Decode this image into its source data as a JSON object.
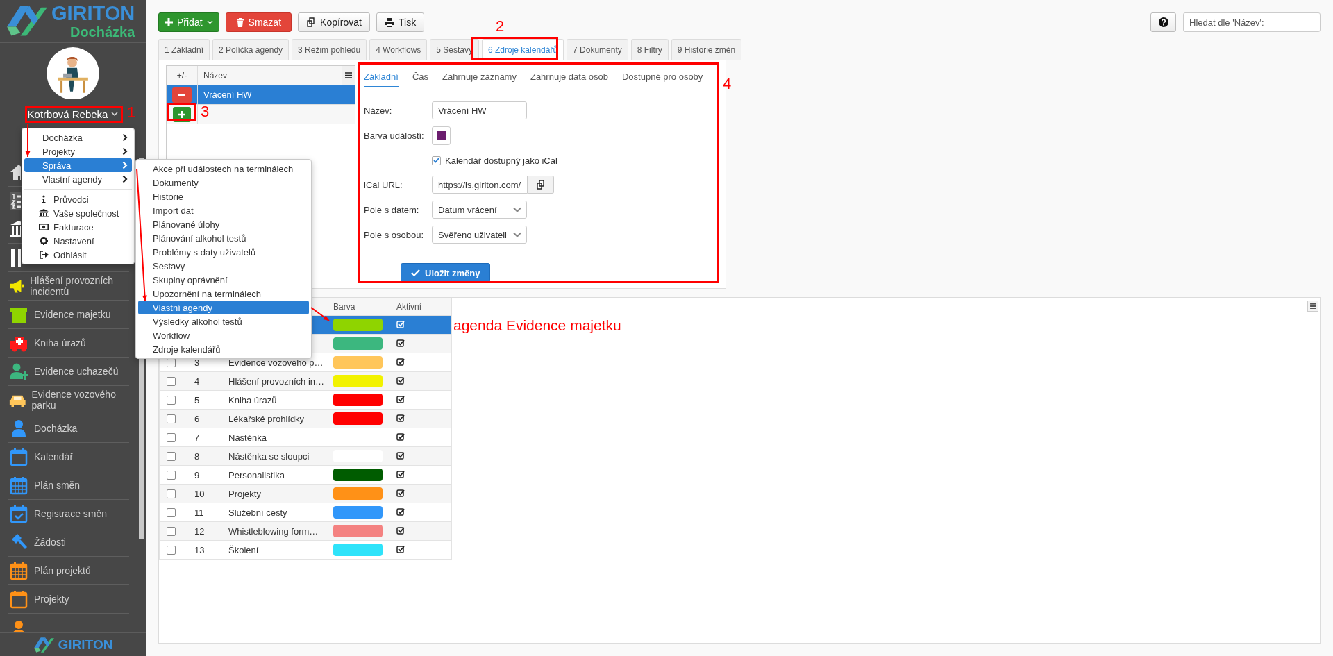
{
  "sidebar": {
    "brand": "GIRITON",
    "product": "Docházka",
    "user": "Kotrbová Rebeka",
    "items": [
      {
        "label": "Hlášení provozních incidentů"
      },
      {
        "label": "Evidence majetku"
      },
      {
        "label": "Kniha úrazů"
      },
      {
        "label": "Evidence uchazečů"
      },
      {
        "label": "Evidence vozového parku"
      },
      {
        "label": "Docházka"
      },
      {
        "label": "Kalendář"
      },
      {
        "label": "Plán směn"
      },
      {
        "label": "Registrace směn"
      },
      {
        "label": "Žádosti"
      },
      {
        "label": "Plán projektů"
      },
      {
        "label": "Projekty"
      }
    ],
    "footer_brand": "GIRITON"
  },
  "toolbar": {
    "buttons": [
      {
        "label": "Přidat",
        "kind": "add"
      },
      {
        "label": "Smazat",
        "kind": "delete"
      },
      {
        "label": "Kopírovat",
        "kind": "copy"
      },
      {
        "label": "Tisk",
        "kind": "print"
      }
    ],
    "search": {
      "placeholder": "Hledat dle 'Název':"
    }
  },
  "tabs": [
    {
      "label": "1 Základní",
      "selected": false
    },
    {
      "label": "2 Políčka agendy",
      "selected": false
    },
    {
      "label": "3 Režim pohledu",
      "selected": false
    },
    {
      "label": "4 Workflows",
      "selected": false
    },
    {
      "label": "5 Sestavy",
      "selected": false
    },
    {
      "label": "6 Zdroje kalendářů",
      "selected": true
    },
    {
      "label": "7 Dokumenty",
      "selected": false
    },
    {
      "label": "8 Filtry",
      "selected": false
    },
    {
      "label": "9 Historie změn",
      "selected": false
    }
  ],
  "sources": {
    "columns": [
      "+/-",
      "Název"
    ],
    "rows": [
      {
        "name": "Vrácení HW",
        "selected": true
      }
    ]
  },
  "editor": {
    "tabs": [
      {
        "label": "Základní",
        "selected": true
      },
      {
        "label": "Čas",
        "selected": false
      },
      {
        "label": "Zahrnuje záznamy",
        "selected": false
      },
      {
        "label": "Zahrnuje data osob",
        "selected": false
      },
      {
        "label": "Dostupné pro osoby",
        "selected": false
      }
    ],
    "fields": [
      {
        "kind": "text",
        "label": "Název:",
        "value": "Vrácení HW"
      },
      {
        "kind": "color",
        "label": "Barva událostí:",
        "color": "#6b1d6e"
      },
      {
        "kind": "checkbox",
        "label": "Kalendář dostupný jako iCal",
        "checked": true
      },
      {
        "kind": "copy",
        "label": "iCal URL:",
        "value": "https://is.giriton.com/"
      },
      {
        "kind": "select",
        "label": "Pole s datem:",
        "value": "Datum vrácení"
      },
      {
        "kind": "select",
        "label": "Pole s osobou:",
        "value": "Svěřeno uživateli"
      }
    ],
    "save": "Uložit změny"
  },
  "agendas": {
    "columns": [
      "Barva",
      "Aktivní"
    ],
    "rows": [
      {
        "color": "#8fd400",
        "active": true,
        "selected": true
      },
      {
        "color": "#3cb77f",
        "active": true,
        "selected": false
      },
      {
        "number": "3",
        "name": "Evidence vozového p…",
        "checked": false,
        "color": "#ffc65a",
        "active": true,
        "selected": false
      },
      {
        "number": "4",
        "name": "Hlášení provozních in…",
        "checked": false,
        "color": "#f2f200",
        "active": true,
        "selected": false
      },
      {
        "number": "5",
        "name": "Kniha úrazů",
        "checked": false,
        "color": "#ff0000",
        "active": true,
        "selected": false
      },
      {
        "number": "6",
        "name": "Lékařské prohlídky",
        "checked": false,
        "color": "#ff0000",
        "active": true,
        "selected": false
      },
      {
        "number": "7",
        "name": "Nástěnka",
        "checked": false,
        "active": true,
        "selected": false
      },
      {
        "number": "8",
        "name": "Nástěnka se sloupci",
        "checked": false,
        "color": "#ffffff",
        "active": true,
        "selected": false
      },
      {
        "number": "9",
        "name": "Personalistika",
        "checked": false,
        "color": "#005c00",
        "active": true,
        "selected": false
      },
      {
        "number": "10",
        "name": "Projekty",
        "checked": false,
        "color": "#ff9117",
        "active": true,
        "selected": false
      },
      {
        "number": "11",
        "name": "Služební cesty",
        "checked": false,
        "color": "#3197fa",
        "active": true,
        "selected": false
      },
      {
        "number": "12",
        "name": "Whistleblowing form…",
        "checked": false,
        "color": "#f48281",
        "active": true,
        "selected": false
      },
      {
        "number": "13",
        "name": "Školení",
        "checked": false,
        "color": "#2ee3fa",
        "active": true,
        "selected": false
      }
    ]
  },
  "user_menu": {
    "items": [
      {
        "label": "Docházka",
        "kind": "submenu",
        "selected": false
      },
      {
        "label": "Projekty",
        "kind": "submenu",
        "selected": false
      },
      {
        "label": "Správa",
        "kind": "submenu",
        "selected": true
      },
      {
        "label": "Vlastní agendy",
        "kind": "submenu",
        "selected": false
      },
      {
        "label": "Průvodci",
        "kind": "action",
        "selected": false
      },
      {
        "label": "Vaše společnost",
        "kind": "action",
        "selected": false
      },
      {
        "label": "Fakturace",
        "kind": "action",
        "selected": false
      },
      {
        "label": "Nastavení",
        "kind": "action",
        "selected": false
      },
      {
        "label": "Odhlásit",
        "kind": "action",
        "selected": false
      }
    ]
  },
  "submenu": {
    "items": [
      {
        "label": "Akce při událostech na terminálech",
        "selected": false
      },
      {
        "label": "Dokumenty",
        "selected": false
      },
      {
        "label": "Historie",
        "selected": false
      },
      {
        "label": "Import dat",
        "selected": false
      },
      {
        "label": "Plánované úlohy",
        "selected": false
      },
      {
        "label": "Plánování alkohol testů",
        "selected": false
      },
      {
        "label": "Problémy s daty uživatelů",
        "selected": false
      },
      {
        "label": "Sestavy",
        "selected": false
      },
      {
        "label": "Skupiny oprávnění",
        "selected": false
      },
      {
        "label": "Upozornění na terminálech",
        "selected": false
      },
      {
        "label": "Vlastní agendy",
        "selected": true
      },
      {
        "label": "Výsledky alkohol testů",
        "selected": false
      },
      {
        "label": "Workflow",
        "selected": false
      },
      {
        "label": "Zdroje kalendářů",
        "selected": false
      }
    ]
  },
  "annotations": {
    "numbers": [
      "1",
      "2",
      "3",
      "4"
    ],
    "note": "agenda Evidence majetku"
  }
}
